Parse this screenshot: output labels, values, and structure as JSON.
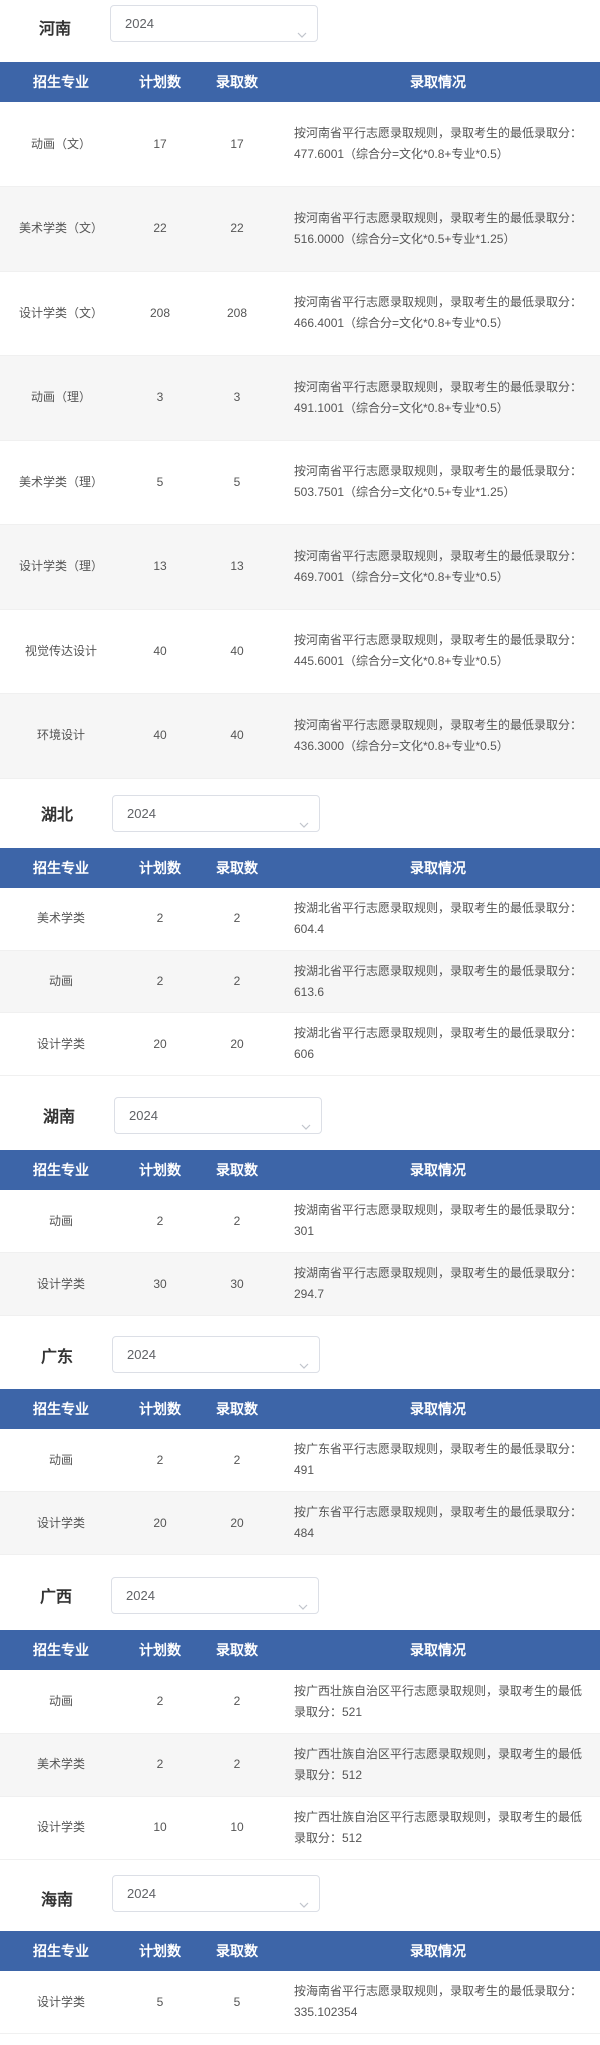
{
  "headers": [
    "招生专业",
    "计划数",
    "录取数",
    "录取情况"
  ],
  "provinces": [
    {
      "name": "河南",
      "year": "2024",
      "rows": [
        {
          "major": "动画（文）",
          "plan": "17",
          "admit": "17",
          "info": "按河南省平行志愿录取规则，录取考生的最低录取分：477.6001（综合分=文化*0.8+专业*0.5）"
        },
        {
          "major": "美术学类（文）",
          "plan": "22",
          "admit": "22",
          "info": "按河南省平行志愿录取规则，录取考生的最低录取分：516.0000（综合分=文化*0.5+专业*1.25）"
        },
        {
          "major": "设计学类（文）",
          "plan": "208",
          "admit": "208",
          "info": "按河南省平行志愿录取规则，录取考生的最低录取分：466.4001（综合分=文化*0.8+专业*0.5）"
        },
        {
          "major": "动画（理）",
          "plan": "3",
          "admit": "3",
          "info": "按河南省平行志愿录取规则，录取考生的最低录取分：491.1001（综合分=文化*0.8+专业*0.5）"
        },
        {
          "major": "美术学类（理）",
          "plan": "5",
          "admit": "5",
          "info": "按河南省平行志愿录取规则，录取考生的最低录取分：503.7501（综合分=文化*0.5+专业*1.25）"
        },
        {
          "major": "设计学类（理）",
          "plan": "13",
          "admit": "13",
          "info": "按河南省平行志愿录取规则，录取考生的最低录取分：469.7001（综合分=文化*0.8+专业*0.5）"
        },
        {
          "major": "视觉传达设计",
          "plan": "40",
          "admit": "40",
          "info": "按河南省平行志愿录取规则，录取考生的最低录取分：445.6001（综合分=文化*0.8+专业*0.5）"
        },
        {
          "major": "环境设计",
          "plan": "40",
          "admit": "40",
          "info": "按河南省平行志愿录取规则，录取考生的最低录取分：436.3000（综合分=文化*0.8+专业*0.5）"
        }
      ]
    },
    {
      "name": "湖北",
      "year": "2024",
      "rows": [
        {
          "major": "美术学类",
          "plan": "2",
          "admit": "2",
          "info": "按湖北省平行志愿录取规则，录取考生的最低录取分：604.4"
        },
        {
          "major": "动画",
          "plan": "2",
          "admit": "2",
          "info": "按湖北省平行志愿录取规则，录取考生的最低录取分：613.6"
        },
        {
          "major": "设计学类",
          "plan": "20",
          "admit": "20",
          "info": "按湖北省平行志愿录取规则，录取考生的最低录取分：606"
        }
      ]
    },
    {
      "name": "湖南",
      "year": "2024",
      "rows": [
        {
          "major": "动画",
          "plan": "2",
          "admit": "2",
          "info": "按湖南省平行志愿录取规则，录取考生的最低录取分：301"
        },
        {
          "major": "设计学类",
          "plan": "30",
          "admit": "30",
          "info": "按湖南省平行志愿录取规则，录取考生的最低录取分：294.7"
        }
      ]
    },
    {
      "name": "广东",
      "year": "2024",
      "rows": [
        {
          "major": "动画",
          "plan": "2",
          "admit": "2",
          "info": "按广东省平行志愿录取规则，录取考生的最低录取分：491"
        },
        {
          "major": "设计学类",
          "plan": "20",
          "admit": "20",
          "info": "按广东省平行志愿录取规则，录取考生的最低录取分：484"
        }
      ]
    },
    {
      "name": "广西",
      "year": "2024",
      "rows": [
        {
          "major": "动画",
          "plan": "2",
          "admit": "2",
          "info": "按广西壮族自治区平行志愿录取规则，录取考生的最低录取分：521"
        },
        {
          "major": "美术学类",
          "plan": "2",
          "admit": "2",
          "info": "按广西壮族自治区平行志愿录取规则，录取考生的最低录取分：512"
        },
        {
          "major": "设计学类",
          "plan": "10",
          "admit": "10",
          "info": "按广西壮族自治区平行志愿录取规则，录取考生的最低录取分：512"
        }
      ]
    },
    {
      "name": "海南",
      "year": "2024",
      "rows": [
        {
          "major": "设计学类",
          "plan": "5",
          "admit": "5",
          "info": "按海南省平行志愿录取规则，录取考生的最低录取分：335.102354"
        }
      ]
    }
  ]
}
